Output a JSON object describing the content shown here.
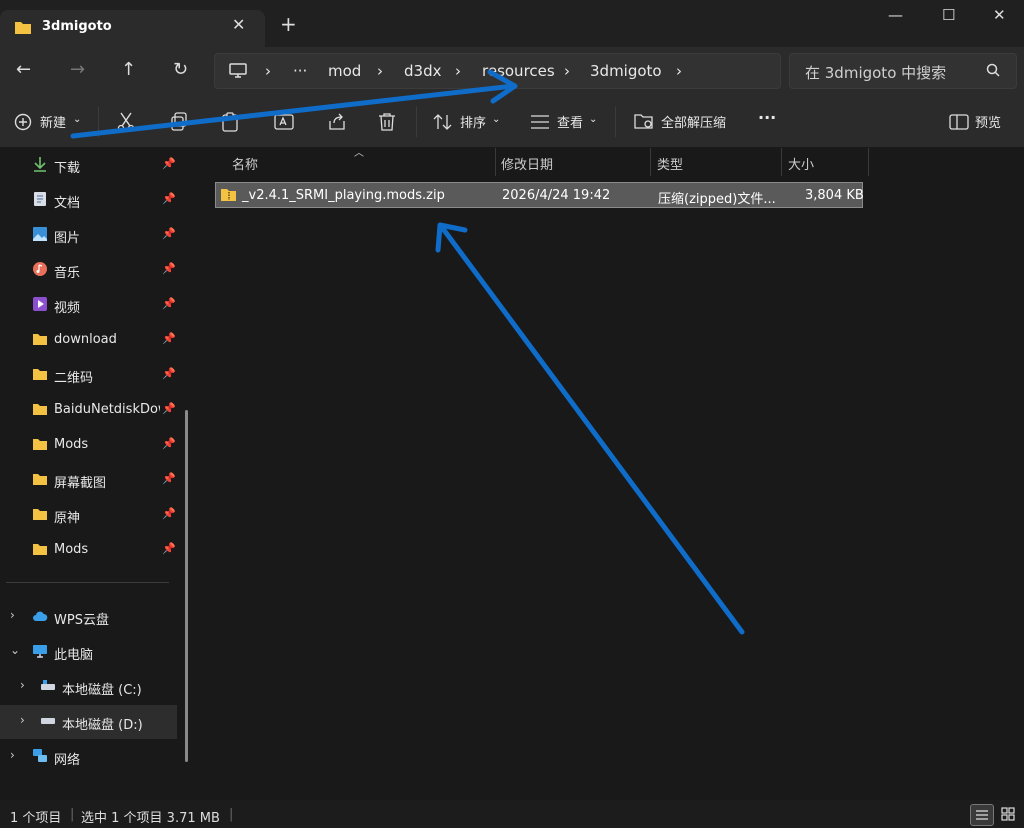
{
  "window": {
    "tab_title": "3dmigoto",
    "tab_close": "✕",
    "new_tab": "+",
    "minimize": "—",
    "maximize": "☐",
    "close": "✕"
  },
  "nav": {
    "back": "←",
    "forward": "→",
    "up": "↑",
    "refresh": "↻"
  },
  "breadcrumb": {
    "more": "···",
    "items": [
      "mod",
      "d3dx",
      "resources",
      "3dmigoto"
    ],
    "sep": "›"
  },
  "search": {
    "placeholder": "在 3dmigoto 中搜索"
  },
  "toolbar": {
    "new_label": "新建",
    "sort_label": "排序",
    "view_label": "查看",
    "extract_all_label": "全部解压缩",
    "more": "···",
    "preview_label": "预览"
  },
  "sidebar": {
    "quick_access": [
      {
        "label": "下载",
        "icon": "download-icon"
      },
      {
        "label": "文档",
        "icon": "document-icon"
      },
      {
        "label": "图片",
        "icon": "pictures-icon"
      },
      {
        "label": "音乐",
        "icon": "music-icon"
      },
      {
        "label": "视频",
        "icon": "video-icon"
      },
      {
        "label": "download",
        "icon": "folder-icon"
      },
      {
        "label": "二维码",
        "icon": "folder-icon"
      },
      {
        "label": "BaiduNetdiskDownload",
        "icon": "folder-icon"
      },
      {
        "label": "Mods",
        "icon": "folder-icon"
      },
      {
        "label": "屏幕截图",
        "icon": "folder-icon"
      },
      {
        "label": "原神",
        "icon": "folder-icon"
      },
      {
        "label": "Mods",
        "icon": "folder-icon"
      }
    ],
    "tree": [
      {
        "label": "WPS云盘",
        "icon": "cloud-icon"
      },
      {
        "label": "此电脑",
        "icon": "pc-icon"
      },
      {
        "label": "本地磁盘 (C:)",
        "icon": "drive-icon"
      },
      {
        "label": "本地磁盘 (D:)",
        "icon": "drive-icon"
      },
      {
        "label": "网络",
        "icon": "network-icon"
      }
    ]
  },
  "columns": {
    "name": "名称",
    "date": "修改日期",
    "type": "类型",
    "size": "大小"
  },
  "files": [
    {
      "name": "_v2.4.1_SRMI_playing.mods.zip",
      "date": "2026/4/24 19:42",
      "type": "压缩(zipped)文件...",
      "size": "3,804 KB"
    }
  ],
  "status": {
    "count": "1 个项目",
    "selected": "选中 1 个项目  3.71 MB"
  },
  "colors": {
    "accent_arrow": "#0f6cc8",
    "folder": "#f3c242"
  }
}
